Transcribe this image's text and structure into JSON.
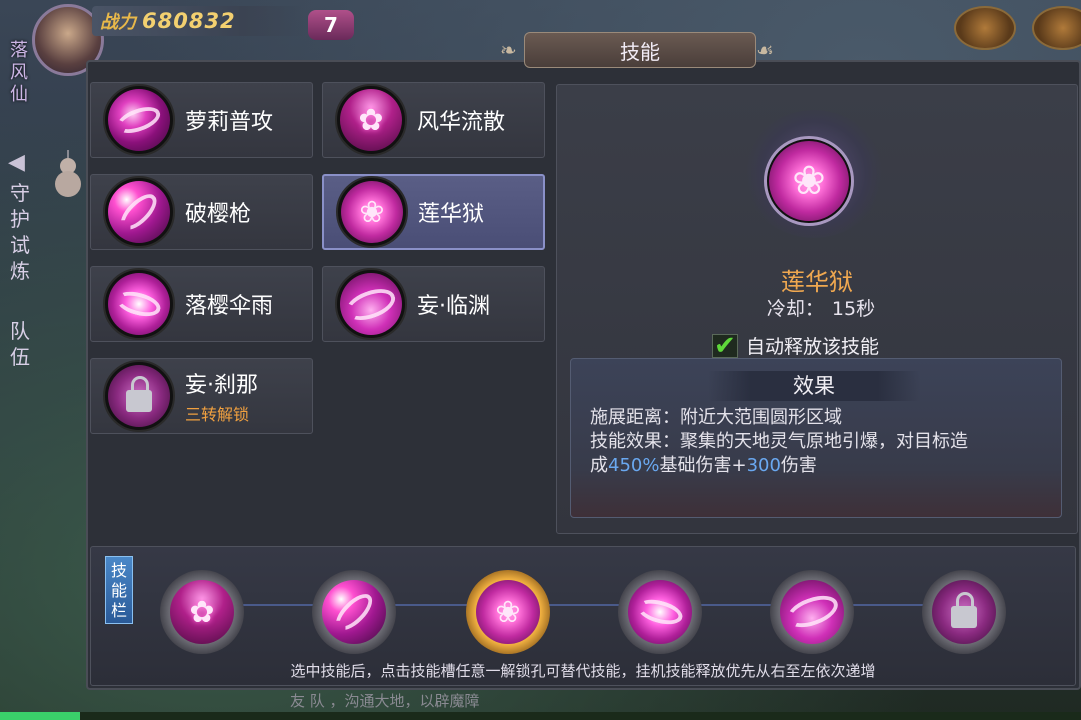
{
  "hud": {
    "power_label": "战力",
    "power_value": "680832",
    "vip_level": "7",
    "player_name": "落风仙"
  },
  "side": {
    "tab1": "守护试炼",
    "tab2": "队伍"
  },
  "panel": {
    "title": "技能"
  },
  "skills": [
    {
      "name": "萝莉普攻",
      "sub": ""
    },
    {
      "name": "风华流散",
      "sub": ""
    },
    {
      "name": "破樱枪",
      "sub": ""
    },
    {
      "name": "莲华狱",
      "sub": ""
    },
    {
      "name": "落樱伞雨",
      "sub": ""
    },
    {
      "name": "妄·临渊",
      "sub": ""
    },
    {
      "name": "妄·刹那",
      "sub": "三转解锁"
    }
  ],
  "detail": {
    "name": "莲华狱",
    "cooldown_label": "冷却：",
    "cooldown_value": "15秒",
    "auto_label": "自动释放该技能",
    "effect_title": "效果",
    "range_line": "施展距离：附近大范围圆形区域",
    "effect_line_a": "技能效果：聚集的天地灵气原地引爆，对目标造",
    "effect_line_b_pre": "成",
    "effect_pct": "450%",
    "effect_line_b_mid": "基础伤害+",
    "effect_flat": "300",
    "effect_line_b_post": "伤害"
  },
  "skill_bar": {
    "tag": "技能栏",
    "hint": "选中技能后，点击技能槽任意一解锁孔可替代技能，挂机技能释放优先从右至左依次递增"
  },
  "chat": {
    "text": "友  队  ，沟通大地，以辟魔障"
  },
  "colors": {
    "accent_orange": "#f0a850",
    "highlight_blue": "#6aa8f0",
    "selected_card": "#5a5e86"
  }
}
